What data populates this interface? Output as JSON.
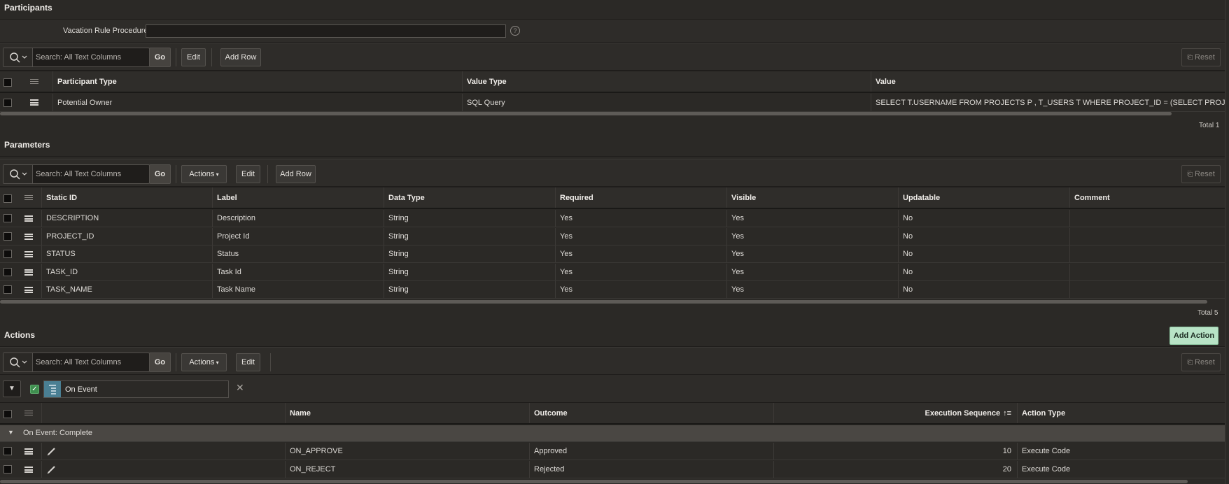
{
  "participants": {
    "title": "Participants",
    "vacation_label": "Vacation Rule Procedure",
    "vacation_value": "",
    "search_placeholder": "Search: All Text Columns",
    "go": "Go",
    "edit": "Edit",
    "add_row": "Add Row",
    "reset": "Reset",
    "columns": [
      "Participant Type",
      "Value Type",
      "Value"
    ],
    "rows": [
      {
        "type": "Potential Owner",
        "value_type": "SQL Query",
        "value": "SELECT T.USERNAME FROM PROJECTS P , T_USERS T WHERE PROJECT_ID = (SELECT PROJECT_ID FROM T_TASK"
      }
    ],
    "total": "Total 1"
  },
  "parameters": {
    "title": "Parameters",
    "search_placeholder": "Search: All Text Columns",
    "go": "Go",
    "actions": "Actions",
    "edit": "Edit",
    "add_row": "Add Row",
    "reset": "Reset",
    "columns": [
      "Static ID",
      "Label",
      "Data Type",
      "Required",
      "Visible",
      "Updatable",
      "Comment"
    ],
    "rows": [
      [
        "DESCRIPTION",
        "Description",
        "String",
        "Yes",
        "Yes",
        "No",
        ""
      ],
      [
        "PROJECT_ID",
        "Project Id",
        "String",
        "Yes",
        "Yes",
        "No",
        ""
      ],
      [
        "STATUS",
        "Status",
        "String",
        "Yes",
        "Yes",
        "No",
        ""
      ],
      [
        "TASK_ID",
        "Task Id",
        "String",
        "Yes",
        "Yes",
        "No",
        ""
      ],
      [
        "TASK_NAME",
        "Task Name",
        "String",
        "Yes",
        "Yes",
        "No",
        ""
      ]
    ],
    "total": "Total 5"
  },
  "actions": {
    "title": "Actions",
    "add_action": "Add Action",
    "search_placeholder": "Search: All Text Columns",
    "go": "Go",
    "actions": "Actions",
    "edit": "Edit",
    "reset": "Reset",
    "filter_label": "On Event",
    "columns": [
      "Name",
      "Outcome",
      "Execution Sequence",
      "Action Type"
    ],
    "group_label": "On Event: Complete",
    "rows": [
      [
        "ON_APPROVE",
        "Approved",
        "10",
        "Execute Code"
      ],
      [
        "ON_REJECT",
        "Rejected",
        "20",
        "Execute Code"
      ]
    ]
  },
  "colors": {
    "background": "#2b2926",
    "add_action_bg": "#b8e3c6",
    "filter_icon_bg": "#4a7f93",
    "check_green": "#3f8f4f"
  }
}
